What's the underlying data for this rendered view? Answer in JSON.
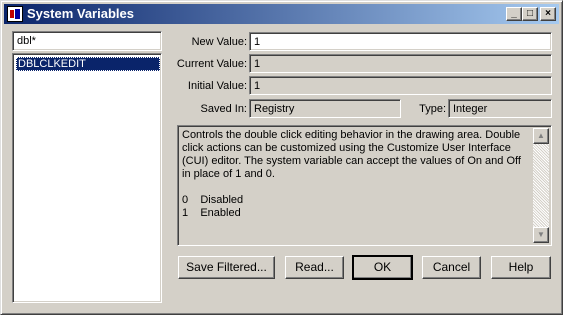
{
  "window": {
    "title": "System Variables",
    "minimize_glyph": "_",
    "maximize_glyph": "□",
    "close_glyph": "×"
  },
  "filter": {
    "value": "dbl*"
  },
  "variable_list": [
    "DBLCLKEDIT"
  ],
  "fields": {
    "new_value_label": "New Value:",
    "new_value": "1",
    "current_value_label": "Current Value:",
    "current_value": "1",
    "initial_value_label": "Initial Value:",
    "initial_value": "1",
    "saved_in_label": "Saved In:",
    "saved_in": "Registry",
    "type_label": "Type:",
    "type": "Integer"
  },
  "description": "Controls the double click editing behavior in the drawing area. Double click actions can be customized using the Customize User Interface (CUI) editor. The system variable can accept the values of On and Off in place of 1 and 0.\n\n0    Disabled\n1    Enabled",
  "buttons": {
    "save_filtered": "Save Filtered...",
    "read": "Read...",
    "ok": "OK",
    "cancel": "Cancel",
    "help": "Help"
  },
  "colors": {
    "face": "#d4d0c8",
    "title_start": "#0a246a",
    "title_end": "#a6caf0",
    "selection": "#0a246a"
  }
}
